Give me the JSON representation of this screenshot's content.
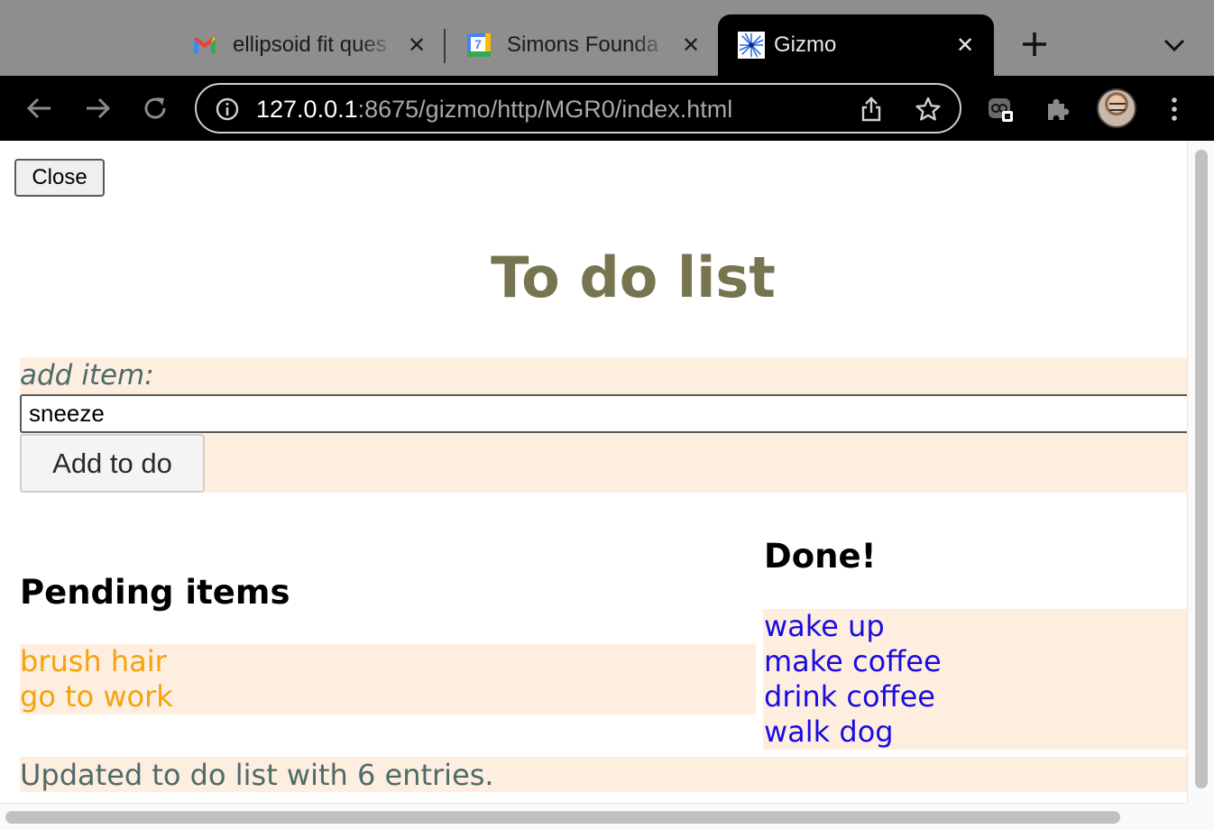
{
  "browser": {
    "tabs": [
      {
        "title": "ellipsoid fit ques",
        "icon": "gmail-icon",
        "active": false
      },
      {
        "title": "Simons Founda",
        "icon": "calendar-icon",
        "calendar_day": "7",
        "active": false
      },
      {
        "title": "Gizmo",
        "icon": "gizmo-icon",
        "active": true
      }
    ],
    "url_host": "127.0.0.1",
    "url_rest": ":8675/gizmo/http/MGR0/index.html"
  },
  "page": {
    "close_label": "Close",
    "heading": "To do list",
    "add_label": "add item:",
    "input_value": "sneeze",
    "add_button_label": "Add to do",
    "pending_title": "Pending items",
    "pending_items": [
      "brush hair",
      "go to work"
    ],
    "done_title": "Done!",
    "done_items": [
      "wake up",
      "make coffee",
      "drink coffee",
      "walk dog"
    ],
    "status": "Updated to do list with 6 entries."
  },
  "colors": {
    "heading": "#767550",
    "panel_bg": "#fdeee0",
    "pending_text": "#f4a30e",
    "done_text": "#1a0ce0",
    "label_text": "#4e6b6b"
  }
}
